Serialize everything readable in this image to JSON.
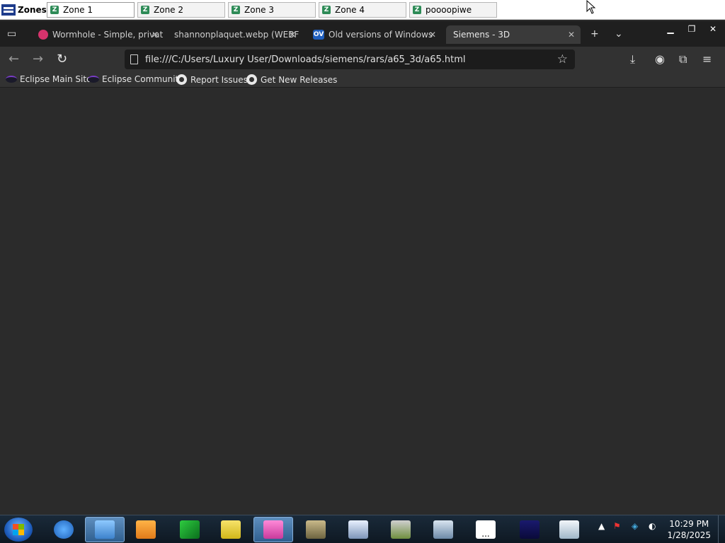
{
  "zones_bar": {
    "label": "Zones",
    "tabs": [
      {
        "label": "Zone 1",
        "active": true
      },
      {
        "label": "Zone 2",
        "active": false
      },
      {
        "label": "Zone 3",
        "active": false
      },
      {
        "label": "Zone 4",
        "active": false
      },
      {
        "label": "poooopiwe",
        "active": false
      }
    ]
  },
  "browser": {
    "tabs": [
      {
        "label": "Wormhole - Simple, privat",
        "favicon_color": "#d6336c"
      },
      {
        "label": "shannonplaquet.webp (WEBF",
        "favicon_color": ""
      },
      {
        "label": "Old versions of Windows",
        "favicon": "OV"
      },
      {
        "label": "Siemens - 3D",
        "active": true
      }
    ],
    "url": "file:///C:/Users/Luxury User/Downloads/siemens/rars/a65_3d/a65.html",
    "bookmarks": [
      {
        "label": "Eclipse Main Site",
        "icon": "eclipse-icon"
      },
      {
        "label": "Eclipse Community",
        "icon": "eclipse-icon"
      },
      {
        "label": "Report Issues",
        "icon": "github-icon"
      },
      {
        "label": "Get New Releases",
        "icon": "github-icon"
      }
    ]
  },
  "taskbar": {
    "clock_time": "10:29 PM",
    "clock_date": "1/28/2025",
    "show_desktop_label": "..."
  },
  "colors": {
    "content_bg": "#2b2b2b",
    "toolbar_bg": "#323232",
    "tabstrip_bg": "#1f1f1f"
  }
}
